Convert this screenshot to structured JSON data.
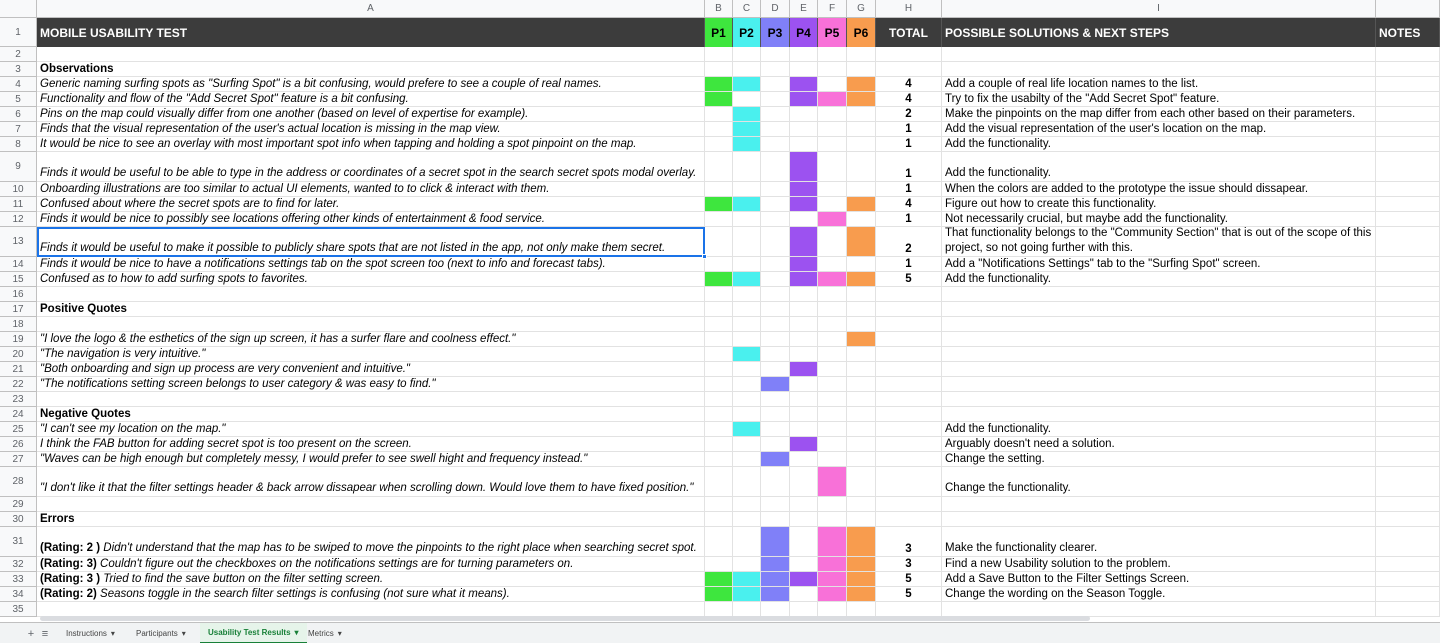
{
  "sheet": {
    "title": "MOBILE USABILITY TEST",
    "columns": [
      "A",
      "B",
      "C",
      "D",
      "E",
      "F",
      "G",
      "H",
      "I"
    ],
    "headers": {
      "p1": "P1",
      "p2": "P2",
      "p3": "P3",
      "p4": "P4",
      "p5": "P5",
      "p6": "P6",
      "total": "TOTAL",
      "solutions": "POSSIBLE SOLUTIONS & NEXT STEPS",
      "notes": "NOTES"
    },
    "participant_colors": {
      "p1": "#3ee63e",
      "p2": "#4af0ee",
      "p3": "#8080f8",
      "p4": "#9c52f0",
      "p5": "#f871d8",
      "p6": "#f89c4e"
    },
    "rows": [
      {
        "n": "1"
      },
      {
        "n": "2",
        "a": "",
        "style": ""
      },
      {
        "n": "3",
        "a": "Observations",
        "style": "bold"
      },
      {
        "n": "4",
        "a": "Generic naming surfing spots as \"Surfing Spot\" is a bit confusing, would prefere to see a couple of real names.",
        "style": "it",
        "p": [
          1,
          1,
          0,
          1,
          0,
          1
        ],
        "total": "4",
        "sol": "Add a couple of real life location names to the list."
      },
      {
        "n": "5",
        "a": "Functionality and flow of the \"Add Secret Spot\"  feature is a bit confusing.",
        "style": "it",
        "p": [
          1,
          0,
          0,
          1,
          1,
          1
        ],
        "total": "4",
        "sol": "Try to fix the usabilty of the \"Add Secret Spot\" feature."
      },
      {
        "n": "6",
        "a": "Pins on the map could visually differ from one another (based on level of expertise for example).",
        "style": "it",
        "p": [
          0,
          1,
          0,
          0,
          0,
          0
        ],
        "total": "2",
        "sol": "Make the pinpoints on the map differ from each other based on their parameters."
      },
      {
        "n": "7",
        "a": "Finds that the visual  representation of the user's actual location is missing in the map view.",
        "style": "it",
        "p": [
          0,
          1,
          0,
          0,
          0,
          0
        ],
        "total": "1",
        "sol": "Add the visual representation of the user's location on the map."
      },
      {
        "n": "8",
        "a": "It would be nice to see an overlay with most important spot info when tapping and holding a spot pinpoint on the map.",
        "style": "it",
        "p": [
          0,
          1,
          0,
          0,
          0,
          0
        ],
        "total": "1",
        "sol": "Add the functionality."
      },
      {
        "n": "9",
        "a": "Finds it would be useful to be able to type in the address or coordinates of a secret spot in the  search secret spots modal overlay.",
        "style": "it",
        "p": [
          0,
          0,
          0,
          1,
          0,
          0
        ],
        "total": "1",
        "sol": "Add the functionality."
      },
      {
        "n": "10",
        "a": "Onboarding illustrations are too similar to actual UI elements, wanted to to click & interact with them.",
        "style": "it",
        "p": [
          0,
          0,
          0,
          1,
          0,
          0
        ],
        "total": "1",
        "sol": "When the colors are added to the prototype the issue should dissapear."
      },
      {
        "n": "11",
        "a": "Confused about where  the secret spots are to  find for later.",
        "style": "it",
        "p": [
          1,
          1,
          0,
          1,
          0,
          1
        ],
        "total": "4",
        "sol": "Figure out how to create this functionality."
      },
      {
        "n": "12",
        "a": "Finds it would be nice to possibly see locations offering other kinds of  entertainment & food service.",
        "style": "it",
        "p": [
          0,
          0,
          0,
          0,
          1,
          0
        ],
        "total": "1",
        "sol": "Not necessarily crucial, but maybe add the functionality."
      },
      {
        "n": "13",
        "a": "Finds it would be useful to make it possible to publicly share spots  that are not listed in the app, not only make them secret.",
        "style": "it",
        "p": [
          0,
          0,
          0,
          1,
          0,
          1
        ],
        "total": "2",
        "sol": "That functionality belongs to the \"Community Section\" that is out of the scope of this project, so not going further with this."
      },
      {
        "n": "14",
        "a": "Finds it would be nice to have a notifications settings tab on the spot screen too (next to info and  forecast tabs).",
        "style": "it",
        "p": [
          0,
          0,
          0,
          1,
          0,
          0
        ],
        "total": "1",
        "sol": "Add a \"Notifications Settings\" tab to the \"Surfing Spot\" screen."
      },
      {
        "n": "15",
        "a": "Confused as to how to add surfing spots to favorites.",
        "style": "it",
        "p": [
          1,
          1,
          0,
          1,
          1,
          1
        ],
        "total": "5",
        "sol": "Add the functionality."
      },
      {
        "n": "16",
        "a": "",
        "style": ""
      },
      {
        "n": "17",
        "a": "Positive Quotes",
        "style": "bold"
      },
      {
        "n": "18",
        "a": "",
        "style": ""
      },
      {
        "n": "19",
        "a": "\"I love the logo & the esthetics of the sign up screen, it has a surfer flare and coolness effect.\"",
        "style": "it",
        "p": [
          0,
          0,
          0,
          0,
          0,
          1
        ]
      },
      {
        "n": "20",
        "a": "\"The navigation is very intuitive.\"",
        "style": "it",
        "p": [
          0,
          1,
          0,
          0,
          0,
          0
        ]
      },
      {
        "n": "21",
        "a": "\"Both onboarding and sign up process are very convenient and intuitive.\"",
        "style": "it",
        "p": [
          0,
          0,
          0,
          1,
          0,
          0
        ]
      },
      {
        "n": "22",
        "a": "\"The notifications setting screen belongs to user category & was easy to find.\"",
        "style": "it",
        "p": [
          0,
          0,
          1,
          0,
          0,
          0
        ]
      },
      {
        "n": "23",
        "a": "",
        "style": ""
      },
      {
        "n": "24",
        "a": "Negative Quotes",
        "style": "bold"
      },
      {
        "n": "25",
        "a": "\"I can't see my location on the map.\"",
        "style": "it",
        "p": [
          0,
          1,
          0,
          0,
          0,
          0
        ],
        "sol": "Add the functionality."
      },
      {
        "n": "26",
        "a": "I think the FAB button for adding secret spot is too present on the screen.",
        "style": "it",
        "p": [
          0,
          0,
          0,
          1,
          0,
          0
        ],
        "sol": "Arguably doesn't need a solution."
      },
      {
        "n": "27",
        "a": "\"Waves can be high enough but completely messy, I would prefer to see swell hight and frequency instead.\"",
        "style": "it",
        "p": [
          0,
          0,
          1,
          0,
          0,
          0
        ],
        "sol": "Change the setting."
      },
      {
        "n": "28",
        "a": "\"I don't like it that the filter settings header & back  arrow dissapear when scrolling down. Would  love them to have fixed position.\"",
        "style": "it",
        "p": [
          0,
          0,
          0,
          0,
          1,
          0
        ],
        "sol": "Change the functionality."
      },
      {
        "n": "29",
        "a": "",
        "style": ""
      },
      {
        "n": "30",
        "a": "Errors",
        "style": "bold"
      },
      {
        "n": "31",
        "rating": "(Rating: 2 )",
        "a": " Didn't understand that the map has to be swiped to move the pinpoints to the right place when searching secret spot.",
        "style": "it",
        "p": [
          0,
          0,
          1,
          0,
          1,
          1
        ],
        "total": "3",
        "sol": "Make the functionality clearer."
      },
      {
        "n": "32",
        "rating": "(Rating: 3)",
        "a": " Couldn't figure out the checkboxes on the notifications settings are for turning parameters  on.",
        "style": "it",
        "p": [
          0,
          0,
          1,
          0,
          1,
          1
        ],
        "total": "3",
        "sol": "Find a new Usability solution to the problem."
      },
      {
        "n": "33",
        "rating": "(Rating: 3 )",
        "a": " Tried to find the save  button on the filter setting screen.",
        "style": "it",
        "p": [
          1,
          1,
          1,
          1,
          1,
          1
        ],
        "total": "5",
        "sol": "Add a Save Button to the Filter Settings Screen."
      },
      {
        "n": "34",
        "rating": "(Rating: 2)",
        "a": " Seasons toggle in the search filter settings is confusing (not sure what it means).",
        "style": "it",
        "p": [
          1,
          1,
          1,
          0,
          1,
          1
        ],
        "total": "5",
        "sol": "Change the wording on the Season Toggle."
      },
      {
        "n": "35",
        "a": "",
        "style": ""
      }
    ]
  },
  "tabs": {
    "add_icon": "+",
    "list_icon": "≡",
    "items": [
      "Instructions",
      "Participants",
      "Usability Test Results",
      "Metrics"
    ],
    "active": "Usability Test Results",
    "dropdown_icon": "▾"
  }
}
